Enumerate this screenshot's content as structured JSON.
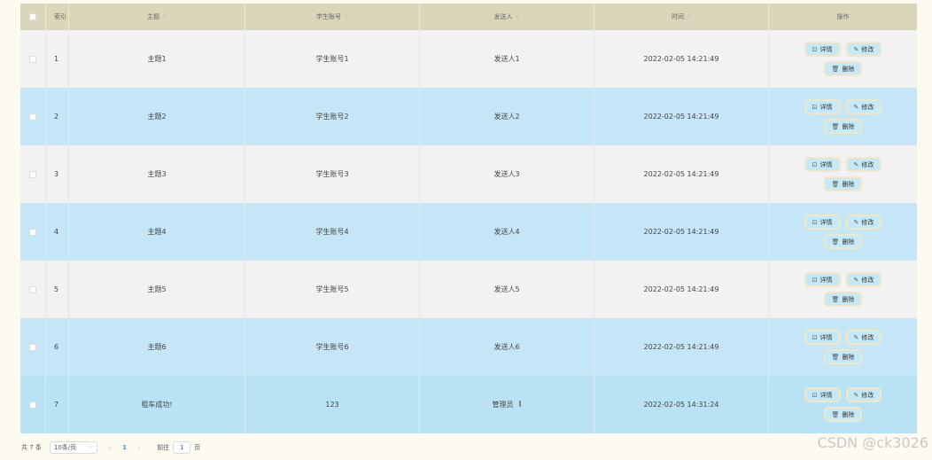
{
  "table": {
    "headers": {
      "index": "索引",
      "subject": "主题",
      "account": "学生账号",
      "sender": "发送人",
      "time": "时间",
      "ops": "操作"
    },
    "actions": {
      "detail": "详情",
      "edit": "修改",
      "delete": "删除"
    },
    "rows": [
      {
        "index": "1",
        "subject": "主题1",
        "account": "学生账号1",
        "sender": "发送人1",
        "time": "2022-02-05 14:21:49"
      },
      {
        "index": "2",
        "subject": "主题2",
        "account": "学生账号2",
        "sender": "发送人2",
        "time": "2022-02-05 14:21:49"
      },
      {
        "index": "3",
        "subject": "主题3",
        "account": "学生账号3",
        "sender": "发送人3",
        "time": "2022-02-05 14:21:49"
      },
      {
        "index": "4",
        "subject": "主题4",
        "account": "学生账号4",
        "sender": "发送人4",
        "time": "2022-02-05 14:21:49"
      },
      {
        "index": "5",
        "subject": "主题5",
        "account": "学生账号5",
        "sender": "发送人5",
        "time": "2022-02-05 14:21:49"
      },
      {
        "index": "6",
        "subject": "主题6",
        "account": "学生账号6",
        "sender": "发送人6",
        "time": "2022-02-05 14:21:49"
      },
      {
        "index": "7",
        "subject": "租车成功!",
        "account": "123",
        "sender": "管理员",
        "time": "2022-02-05 14:31:24"
      }
    ]
  },
  "pagination": {
    "total": "共 7 条",
    "page_size": "10条/页",
    "current_page": "1",
    "goto_label": "前往",
    "goto_value": "1",
    "page_unit": "页"
  },
  "watermark": "CSDN @ck3026"
}
